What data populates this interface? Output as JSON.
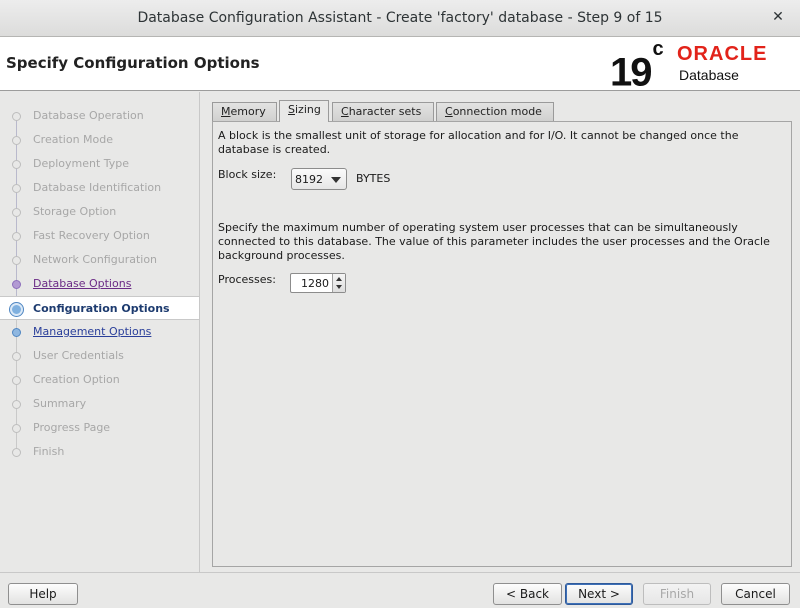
{
  "window": {
    "title": "Database Configuration Assistant - Create 'factory' database - Step 9 of 15",
    "close_glyph": "✕"
  },
  "header": {
    "page_title": "Specify Configuration Options",
    "logo": {
      "version": "19",
      "version_sup": "c",
      "brand": "ORACLE",
      "product": "Database",
      "brand_color": "#e2231a"
    }
  },
  "steps": [
    {
      "label": "Database Operation",
      "state": "disabled"
    },
    {
      "label": "Creation Mode",
      "state": "disabled"
    },
    {
      "label": "Deployment Type",
      "state": "disabled"
    },
    {
      "label": "Database Identification",
      "state": "disabled"
    },
    {
      "label": "Storage Option",
      "state": "disabled"
    },
    {
      "label": "Fast Recovery Option",
      "state": "disabled"
    },
    {
      "label": "Network Configuration",
      "state": "disabled"
    },
    {
      "label": "Database Options",
      "state": "visited"
    },
    {
      "label": "Configuration Options",
      "state": "current"
    },
    {
      "label": "Management Options",
      "state": "link"
    },
    {
      "label": "User Credentials",
      "state": "disabled"
    },
    {
      "label": "Creation Option",
      "state": "disabled"
    },
    {
      "label": "Summary",
      "state": "disabled"
    },
    {
      "label": "Progress Page",
      "state": "disabled"
    },
    {
      "label": "Finish",
      "state": "disabled"
    }
  ],
  "tabs": [
    {
      "label": "Memory",
      "mnemonic": "M",
      "rest": "emory",
      "active": false
    },
    {
      "label": "Sizing",
      "mnemonic": "S",
      "rest": "izing",
      "active": true
    },
    {
      "label": "Character sets",
      "mnemonic": "C",
      "rest": "haracter sets",
      "active": false
    },
    {
      "label": "Connection mode",
      "mnemonic": "C",
      "rest": "onnection mode",
      "active": false
    }
  ],
  "sizing": {
    "block_description": "A block is the smallest unit of storage for allocation and for I/O. It cannot be changed once the database is created.",
    "block_size_label": "Block size:",
    "block_size_value": "8192",
    "block_size_units": "BYTES",
    "processes_description": "Specify the maximum number of operating system user processes that can be simultaneously connected to this database. The value of this parameter includes the user processes and the Oracle background processes.",
    "processes_label": "Processes:",
    "processes_value": "1280"
  },
  "footer": {
    "help": "Help",
    "back": "< Back",
    "next": "Next >",
    "finish": "Finish",
    "cancel": "Cancel"
  }
}
